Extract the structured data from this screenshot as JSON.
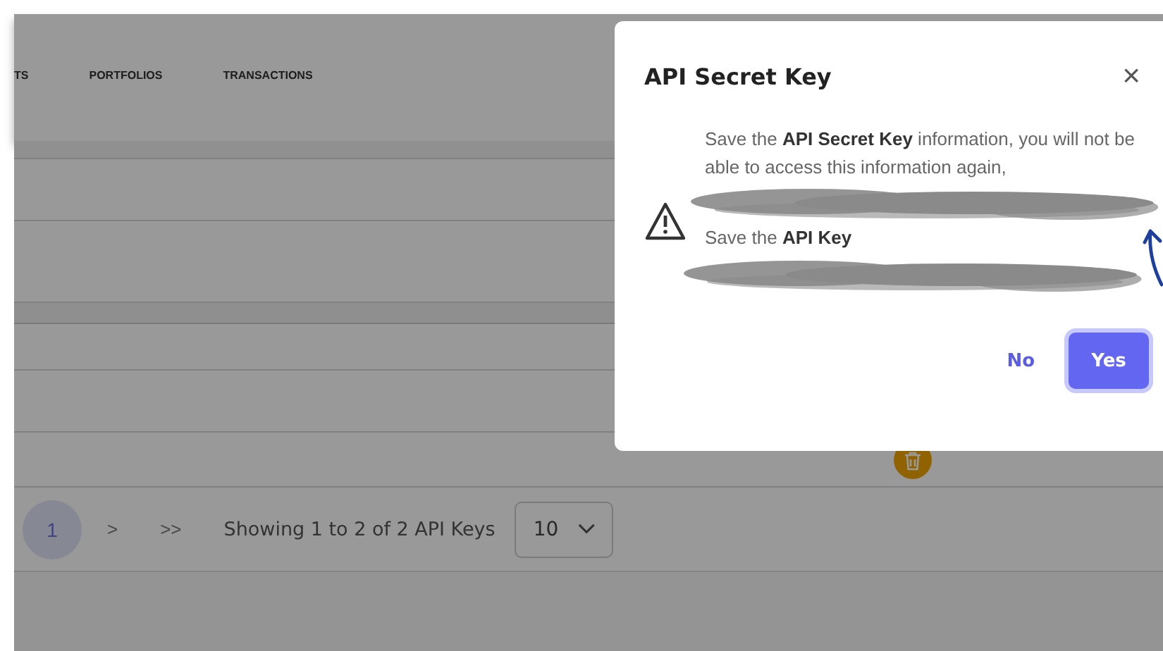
{
  "nav": {
    "tabs": [
      {
        "label": "TS"
      },
      {
        "label": "PORTFOLIOS"
      },
      {
        "label": "TRANSACTIONS"
      }
    ]
  },
  "table": {
    "rows": [
      {
        "kind": "plain"
      },
      {
        "kind": "plain"
      },
      {
        "kind": "header"
      },
      {
        "kind": "short"
      },
      {
        "kind": "plain"
      },
      {
        "kind": "delete"
      }
    ]
  },
  "pagination": {
    "pages": [
      {
        "label": "1",
        "selected": true
      }
    ],
    "next": ">",
    "last": ">>",
    "summary": "Showing 1 to 2 of 2 API Keys",
    "page_size": "10"
  },
  "dialog": {
    "title": "API Secret Key",
    "close": "×",
    "message": "Save the **API Secret Key** information, you will not be able to access this information again,",
    "key_label": "Save the **API Key**",
    "buttons": [
      {
        "label": "No",
        "kind": "text"
      },
      {
        "label": "Yes",
        "kind": "primary"
      }
    ]
  }
}
